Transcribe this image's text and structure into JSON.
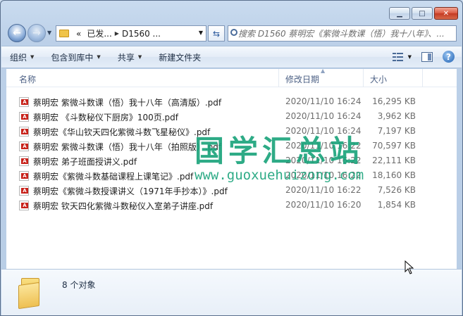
{
  "window": {
    "caption_buttons": {
      "minimize": "▁",
      "maximize": "□",
      "close": "✕"
    }
  },
  "nav": {
    "back_icon": "arrow-left-icon",
    "forward_icon": "arrow-right-icon",
    "address_prefix": "«",
    "address_segments": [
      "已发...",
      "D1560 ..."
    ],
    "search_placeholder": "搜索 D1560 蔡明宏《紫微斗数课（悟）我十八年》、..."
  },
  "toolbar": {
    "organize": "组织",
    "include_in_library": "包含到库中",
    "share": "共享",
    "new_folder": "新建文件夹"
  },
  "columns": {
    "name": "名称",
    "date_modified": "修改日期",
    "size": "大小"
  },
  "files": [
    {
      "name": "蔡明宏 紫微斗数课（悟）我十八年（高清版）.pdf",
      "date": "2020/11/10 16:24",
      "size": "16,295 KB"
    },
    {
      "name": "蔡明宏 《斗数秘仪下厨房》100页.pdf",
      "date": "2020/11/10 16:24",
      "size": "3,962 KB"
    },
    {
      "name": "蔡明宏《华山钦天四化紫微斗数飞星秘仪》.pdf",
      "date": "2020/11/10 16:24",
      "size": "7,197 KB"
    },
    {
      "name": "蔡明宏 紫微斗数课（悟）我十八年（拍照版）.pdf",
      "date": "2020/11/10 16:22",
      "size": "70,597 KB"
    },
    {
      "name": "蔡明宏 弟子班面授讲义.pdf",
      "date": "2020/11/10 16:22",
      "size": "22,111 KB"
    },
    {
      "name": "蔡明宏《紫微斗数基础课程上课笔记》.pdf",
      "date": "2020/11/10 16:22",
      "size": "18,160 KB"
    },
    {
      "name": "蔡明宏《紫微斗数授课讲义（1971年手抄本）》.pdf",
      "date": "2020/11/10 16:22",
      "size": "7,526 KB"
    },
    {
      "name": "蔡明宏 钦天四化紫微斗数秘仪入室弟子讲座.pdf",
      "date": "2020/11/10 16:20",
      "size": "1,854 KB"
    }
  ],
  "watermark": {
    "title": "国学汇总站",
    "url": "www.guoxuehuizong.com"
  },
  "details": {
    "status": "8 个对象"
  },
  "colors": {
    "accent": "#18a37a",
    "pdf_red": "#c8221a",
    "folder_yellow": "#f0c44a"
  }
}
